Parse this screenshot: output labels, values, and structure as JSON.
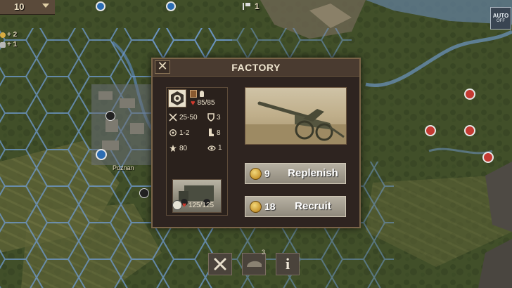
{
  "hud": {
    "turn_value": "10",
    "income_gold": "+ 2",
    "income_steel": "+ 1",
    "flag_count": "1",
    "auto_label": "AUTO",
    "auto_state": "OFF",
    "city_name": "Poznan"
  },
  "dialog": {
    "title": "FACTORY",
    "unit_stats": {
      "health": "85/85",
      "attack": "25-50",
      "defense": "3",
      "range": "1-2",
      "movement": "8",
      "organization": "80",
      "vision": "1"
    },
    "transport": {
      "health": "125/125"
    },
    "replenish": {
      "cost": "9",
      "label": "Replenish"
    },
    "recruit": {
      "cost": "18",
      "label": "Recruit"
    }
  },
  "toolbar": {
    "badge_count": "3"
  },
  "colors": {
    "panel_bg": "#2e2420",
    "panel_border": "#7a6448",
    "button_bg": "#a39d90",
    "gold": "#d8ac42",
    "health_red": "#d23a2e"
  },
  "icons": {
    "close": "close-icon",
    "coin": "coin-icon",
    "build": "build-icon",
    "supply": "supply-icon",
    "info": "info-icon"
  }
}
